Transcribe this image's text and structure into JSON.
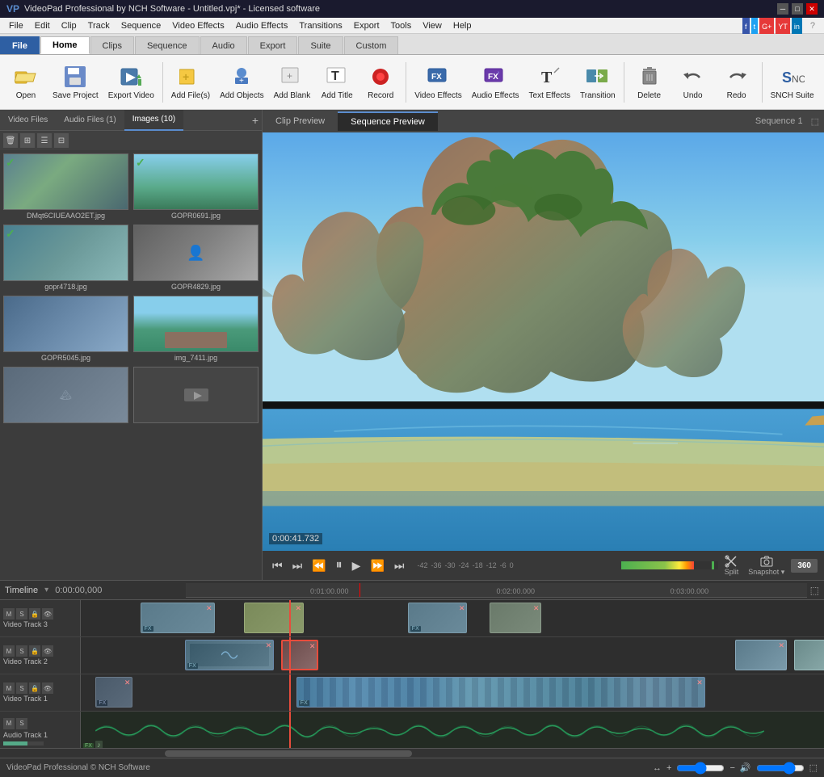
{
  "titlebar": {
    "title": "VideoPad Professional by NCH Software - Untitled.vpj* - Licensed software",
    "win_min": "─",
    "win_max": "□",
    "win_close": "✕"
  },
  "menubar": {
    "items": [
      "File",
      "Edit",
      "Clip",
      "Track",
      "Sequence",
      "Video Effects",
      "Audio Effects",
      "Transitions",
      "Export",
      "Tools",
      "View",
      "Help"
    ]
  },
  "tabs": [
    {
      "label": "File",
      "id": "file",
      "active": false,
      "is_file": true
    },
    {
      "label": "Home",
      "id": "home",
      "active": true
    },
    {
      "label": "Clips",
      "id": "clips"
    },
    {
      "label": "Sequence",
      "id": "sequence"
    },
    {
      "label": "Audio",
      "id": "audio"
    },
    {
      "label": "Export",
      "id": "export"
    },
    {
      "label": "Suite",
      "id": "suite"
    },
    {
      "label": "Custom",
      "id": "custom"
    }
  ],
  "toolbar": {
    "buttons": [
      {
        "id": "open",
        "label": "Open",
        "icon": "folder"
      },
      {
        "id": "save-project",
        "label": "Save Project",
        "icon": "save"
      },
      {
        "id": "export-video",
        "label": "Export Video",
        "icon": "export"
      },
      {
        "id": "add-files",
        "label": "Add File(s)",
        "icon": "add-file"
      },
      {
        "id": "add-objects",
        "label": "Add Objects",
        "icon": "add-objects"
      },
      {
        "id": "add-blank",
        "label": "Add Blank",
        "icon": "blank"
      },
      {
        "id": "add-title",
        "label": "Add Title",
        "icon": "title"
      },
      {
        "id": "record",
        "label": "Record",
        "icon": "record"
      },
      {
        "id": "video-effects",
        "label": "Video Effects",
        "icon": "vfx"
      },
      {
        "id": "audio-effects",
        "label": "Audio Effects",
        "icon": "afxicon"
      },
      {
        "id": "text-effects",
        "label": "Text Effects",
        "icon": "text"
      },
      {
        "id": "transition",
        "label": "Transition",
        "icon": "transition"
      },
      {
        "id": "delete",
        "label": "Delete",
        "icon": "delete"
      },
      {
        "id": "undo",
        "label": "Undo",
        "icon": "undo"
      },
      {
        "id": "redo",
        "label": "Redo",
        "icon": "redo"
      },
      {
        "id": "nch-suite",
        "label": "SNCH Suite",
        "icon": "nch"
      }
    ]
  },
  "media_tabs": {
    "items": [
      "Video Files",
      "Audio Files (1)",
      "Images (10)"
    ],
    "active": 2
  },
  "media_items": [
    {
      "filename": "DMqt6CIUEAAO2ET.jpg",
      "has_check": true
    },
    {
      "filename": "GOPR0691.jpg",
      "has_check": true
    },
    {
      "filename": "gopr4718.jpg",
      "has_check": true
    },
    {
      "filename": "GOPR4829.jpg",
      "has_check": false
    },
    {
      "filename": "GOPR5045.jpg",
      "has_check": false
    },
    {
      "filename": "img_7411.jpg",
      "has_check": false
    },
    {
      "filename": "",
      "has_check": false
    },
    {
      "filename": "",
      "has_check": false
    }
  ],
  "preview": {
    "tabs": [
      "Clip Preview",
      "Sequence Preview"
    ],
    "active_tab": "Sequence Preview",
    "sequence_title": "Sequence 1",
    "timestamp": "0:00:41.732"
  },
  "controls": {
    "buttons": [
      "⏮",
      "⏭",
      "⏪",
      "⏸",
      "▶",
      "⏩",
      "⏭"
    ]
  },
  "timeline": {
    "label": "Timeline",
    "time": "0:00:00,000",
    "time_marks": [
      "0:01:00.000",
      "0:02:00.000",
      "0:03:00.000"
    ],
    "tracks": [
      {
        "name": "Video Track 3",
        "type": "video"
      },
      {
        "name": "Video Track 2",
        "type": "video"
      },
      {
        "name": "Video Track 1",
        "type": "video"
      },
      {
        "name": "Audio Track 1",
        "type": "audio"
      }
    ]
  },
  "statusbar": {
    "left": "VideoPad Professional © NCH Software",
    "zoom_in": "+",
    "zoom_out": "−",
    "fit": "↔",
    "volume": "🔊"
  }
}
